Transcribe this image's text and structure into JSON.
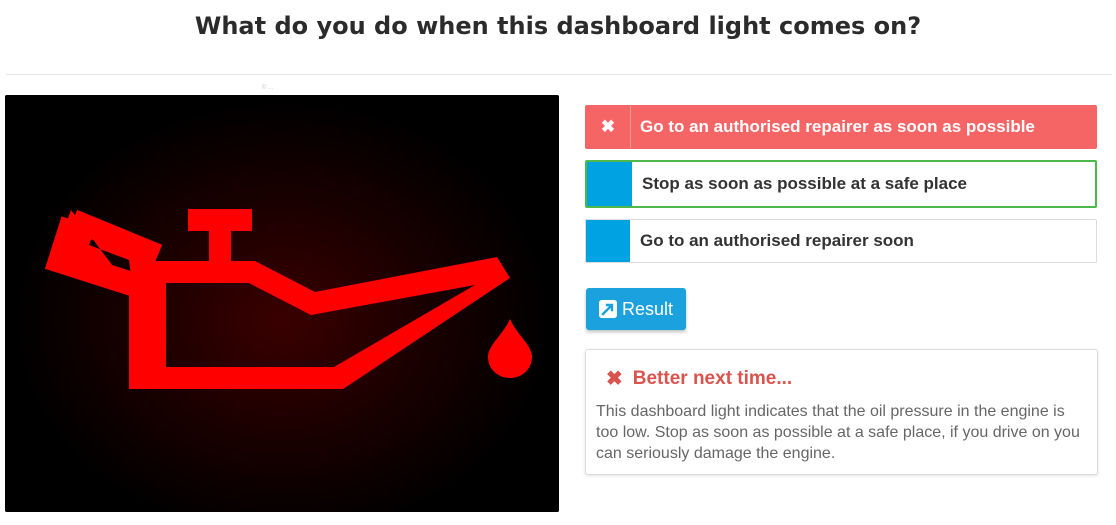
{
  "question": {
    "title": "What do you do when this dashboard light comes on?",
    "image_credit": "© ..."
  },
  "image": {
    "icon": "oil-pressure-warning-icon",
    "background": "#000000",
    "icon_color": "#ff0000"
  },
  "answers": [
    {
      "label": "Go to an authorised repairer as soon as possible",
      "state": "wrong-selected",
      "marker": "✖"
    },
    {
      "label": "Stop as soon as possible at a safe place",
      "state": "correct",
      "marker": ""
    },
    {
      "label": "Go to an authorised repairer soon",
      "state": "neutral",
      "marker": ""
    }
  ],
  "result_button": {
    "label": "Result",
    "icon": "external-link-icon"
  },
  "feedback": {
    "icon": "✖",
    "heading": "Better next time...",
    "text": "This dashboard light indicates that the oil pressure in the engine is too low. Stop as soon as possible at a safe place, if you drive on you can seriously damage the engine."
  },
  "colors": {
    "wrong": "#f56565",
    "correct_border": "#4cb84c",
    "marker_blue": "#00a2e2",
    "button_blue": "#1ba1de",
    "feedback_red": "#d9534f"
  }
}
